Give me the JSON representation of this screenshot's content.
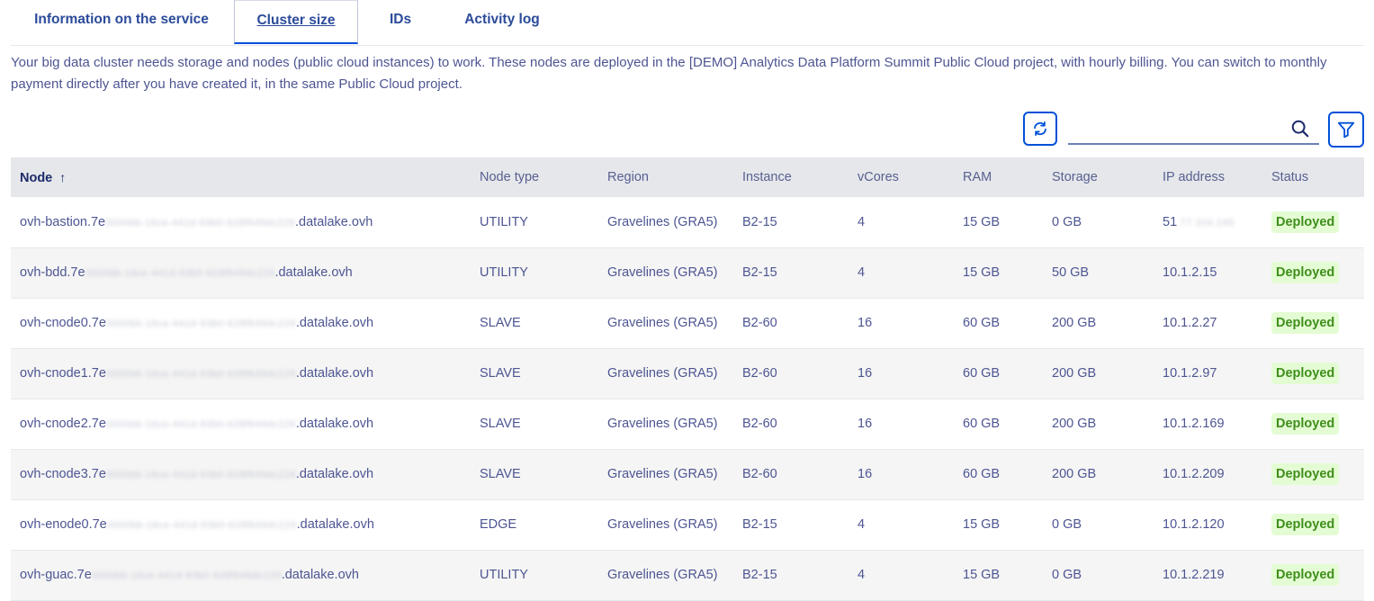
{
  "tabs": [
    {
      "label": "Information on the service"
    },
    {
      "label": "Cluster size"
    },
    {
      "label": "IDs"
    },
    {
      "label": "Activity log"
    }
  ],
  "intro": "Your big data cluster needs storage and nodes (public cloud instances) to work. These nodes are deployed in the [DEMO] Analytics Data Platform Summit Public Cloud project, with hourly billing. You can switch to monthly payment directly after you have created it, in the same Public Cloud project.",
  "search": {
    "placeholder": "",
    "value": ""
  },
  "colors": {
    "accent": "#0050d7",
    "deployed_bg": "#e4fcd3",
    "deployed_text": "#3f8e1c",
    "header_bg": "#e6e7eb"
  },
  "icons": {
    "refresh": "refresh-icon",
    "search": "search-icon",
    "filter": "filter-icon",
    "sort": "sort-ascending-icon"
  },
  "table": {
    "columns": [
      "Node",
      "Node type",
      "Region",
      "Instance",
      "vCores",
      "RAM",
      "Storage",
      "IP address",
      "Status"
    ],
    "sort_arrow": "↑",
    "rows": [
      {
        "prefix": "ovh-bastion.7e",
        "masked": "0000bb-16ce-441d-93b0-628f649dc229",
        "suffix": ".datalake.ovh",
        "type": "UTILITY",
        "region": "Gravelines (GRA5)",
        "instance": "B2-15",
        "vcores": "4",
        "ram": "15 GB",
        "storage": "0 GB",
        "ip": "51",
        "ip_masked": ".77.204.245",
        "status": "Deployed"
      },
      {
        "prefix": "ovh-bdd.7e",
        "masked": "0000bb-16ce-441d-93b0-628f649dc229",
        "suffix": ".datalake.ovh",
        "type": "UTILITY",
        "region": "Gravelines (GRA5)",
        "instance": "B2-15",
        "vcores": "4",
        "ram": "15 GB",
        "storage": "50 GB",
        "ip": "10.1.2.15",
        "ip_masked": "",
        "status": "Deployed"
      },
      {
        "prefix": "ovh-cnode0.7e",
        "masked": "0000bb-16ce-441d-93b0-628f649dc229",
        "suffix": ".datalake.ovh",
        "type": "SLAVE",
        "region": "Gravelines (GRA5)",
        "instance": "B2-60",
        "vcores": "16",
        "ram": "60 GB",
        "storage": "200 GB",
        "ip": "10.1.2.27",
        "ip_masked": "",
        "status": "Deployed"
      },
      {
        "prefix": "ovh-cnode1.7e",
        "masked": "0000bb-16ce-441d-93b0-628f649dc229",
        "suffix": ".datalake.ovh",
        "type": "SLAVE",
        "region": "Gravelines (GRA5)",
        "instance": "B2-60",
        "vcores": "16",
        "ram": "60 GB",
        "storage": "200 GB",
        "ip": "10.1.2.97",
        "ip_masked": "",
        "status": "Deployed"
      },
      {
        "prefix": "ovh-cnode2.7e",
        "masked": "0000bb-16ce-441d-93b0-628f649dc229",
        "suffix": ".datalake.ovh",
        "type": "SLAVE",
        "region": "Gravelines (GRA5)",
        "instance": "B2-60",
        "vcores": "16",
        "ram": "60 GB",
        "storage": "200 GB",
        "ip": "10.1.2.169",
        "ip_masked": "",
        "status": "Deployed"
      },
      {
        "prefix": "ovh-cnode3.7e",
        "masked": "0000bb-16ce-441d-93b0-628f649dc229",
        "suffix": ".datalake.ovh",
        "type": "SLAVE",
        "region": "Gravelines (GRA5)",
        "instance": "B2-60",
        "vcores": "16",
        "ram": "60 GB",
        "storage": "200 GB",
        "ip": "10.1.2.209",
        "ip_masked": "",
        "status": "Deployed"
      },
      {
        "prefix": "ovh-enode0.7e",
        "masked": "0000bb-16ce-441d-93b0-628f649dc229",
        "suffix": ".datalake.ovh",
        "type": "EDGE",
        "region": "Gravelines (GRA5)",
        "instance": "B2-15",
        "vcores": "4",
        "ram": "15 GB",
        "storage": "0 GB",
        "ip": "10.1.2.120",
        "ip_masked": "",
        "status": "Deployed"
      },
      {
        "prefix": "ovh-guac.7e",
        "masked": "0000bb-16ce-441d-93b0-628f649dc229",
        "suffix": ".datalake.ovh",
        "type": "UTILITY",
        "region": "Gravelines (GRA5)",
        "instance": "B2-15",
        "vcores": "4",
        "ram": "15 GB",
        "storage": "0 GB",
        "ip": "10.1.2.219",
        "ip_masked": "",
        "status": "Deployed"
      }
    ]
  }
}
